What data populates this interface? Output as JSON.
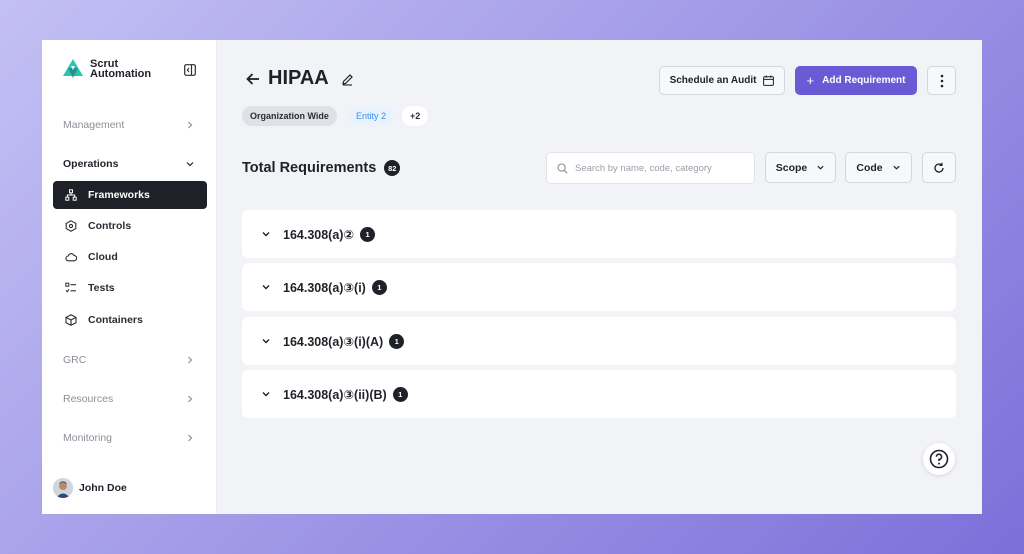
{
  "brand": {
    "name_line1": "Scrut",
    "name_line2": "Automation",
    "accent": "#2bc3b4"
  },
  "sidebar": {
    "sections": [
      {
        "label": "Management"
      },
      {
        "label": "Operations"
      },
      {
        "label": "GRC"
      },
      {
        "label": "Resources"
      },
      {
        "label": "Monitoring"
      }
    ],
    "items": [
      {
        "label": "Frameworks",
        "icon": "sitemap-icon"
      },
      {
        "label": "Controls",
        "icon": "hexagon-icon"
      },
      {
        "label": "Cloud",
        "icon": "cloud-icon"
      },
      {
        "label": "Tests",
        "icon": "checklist-icon"
      },
      {
        "label": "Containers",
        "icon": "box-icon"
      }
    ],
    "user": {
      "name": "John Doe"
    }
  },
  "header": {
    "title": "HIPAA",
    "chips": [
      "Organization Wide",
      "Entity 2",
      "+2"
    ],
    "schedule_label": "Schedule an Audit",
    "add_label": "Add Requirement",
    "accent": "#6a5ad6"
  },
  "toolbar": {
    "total_label": "Total Requirements",
    "total_count": "82",
    "search_placeholder": "Search by name, code, category",
    "scope_label": "Scope",
    "code_label": "Code"
  },
  "requirements": [
    {
      "code": "164.308(a)②",
      "count": "1"
    },
    {
      "code": "164.308(a)③(i)",
      "count": "1"
    },
    {
      "code": "164.308(a)③(i)(A)",
      "count": "1"
    },
    {
      "code": "164.308(a)③(ii)(B)",
      "count": "1"
    }
  ]
}
